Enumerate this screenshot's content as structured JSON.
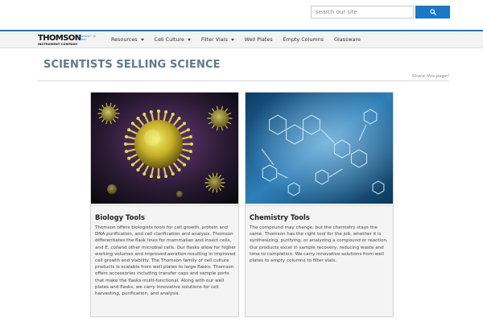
{
  "search": {
    "placeholder": "search our site",
    "button_icon": "search-icon",
    "button_color": "#1b78c5"
  },
  "brand": {
    "logo_main": "THOMSON",
    "logo_sub": "INSTRUMENT COMPANY",
    "logo_tag": "Solutions™ in Motion"
  },
  "nav": {
    "items": [
      {
        "label": "Resources",
        "has_dropdown": true
      },
      {
        "label": "Cell Culture",
        "has_dropdown": true
      },
      {
        "label": "Filter Vials",
        "has_dropdown": true
      },
      {
        "label": "Well Plates",
        "has_dropdown": false
      },
      {
        "label": "Empty Columns",
        "has_dropdown": false
      },
      {
        "label": "Glassware",
        "has_dropdown": false
      }
    ]
  },
  "page": {
    "title": "SCIENTISTS SELLING SCIENCE",
    "share_label": "Share this page!"
  },
  "cards": [
    {
      "title": "Biology Tools",
      "text_before": "Thomson offers biologists tools for cell growth, protein and DNA purification, and cell clarification and analysis. Thomson differentiates the flask lines for mammalian and insect cells, and ",
      "text_italic": "E. coli",
      "text_after": "and other microbial cells. Our flasks allow for higher working volumes and improved aeration resulting in improved cell growth and viability. The Thomson family of cell culture products is scalable from well plates to large flasks. Thomson offers accessories including transfer caps and sample ports that make the flasks multi-functional. Along with our well plates and flasks, we carry innovative solutions for cell harvesting, purification, and analysis.",
      "image_icon": "virus-illustration"
    },
    {
      "title": "Chemistry Tools",
      "text_before": "The compound may change, but the chemistry stays the same. Thomson has the right tool for the job, whether it is synthesizing, purifying, or analyzing a compound or reaction. Our products excel in sample recovery, reducing waste and time to completion. We carry innovative solutions from well plates to empty columns to filter vials.",
      "text_italic": "",
      "text_after": "",
      "image_icon": "molecule-structure-illustration"
    }
  ],
  "colors": {
    "accent": "#1b78c5",
    "title": "#5d7a89",
    "nav_bg": "#f3f3f3",
    "card_body_bg": "#f4f4f4"
  }
}
